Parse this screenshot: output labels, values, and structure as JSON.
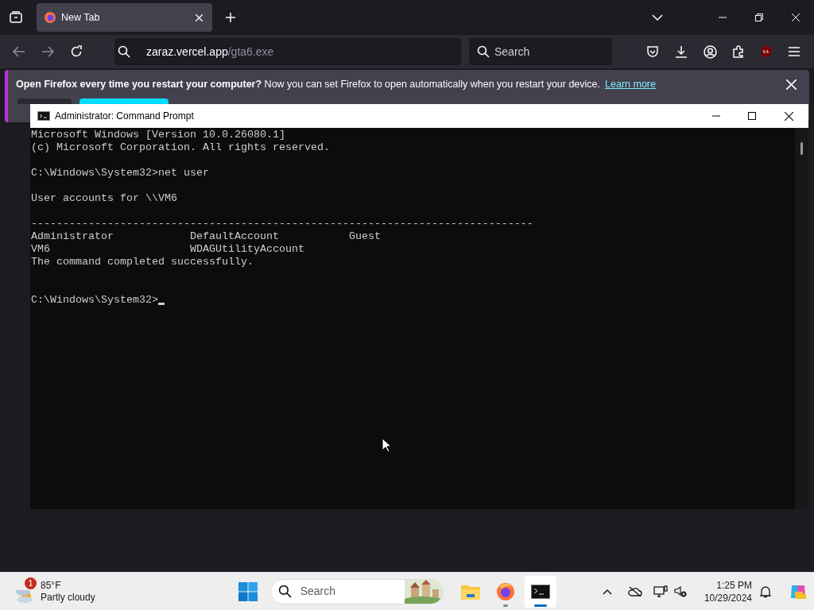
{
  "browser": {
    "tabs": [
      {
        "label": "New Tab",
        "selected": true
      }
    ],
    "url": {
      "host": "zaraz.vercel.app",
      "path": "/gta6.exe"
    },
    "search": {
      "placeholder": "Search"
    },
    "notification": {
      "bold": "Open Firefox every time you restart your computer?",
      "text": "Now you can set Firefox to open automatically when you restart your device.",
      "link": "Learn more"
    },
    "page_buttons": [
      {
        "kind": "secondary"
      },
      {
        "kind": "primary"
      }
    ]
  },
  "console": {
    "title": "Administrator: Command Prompt",
    "blocks": [
      [
        "Microsoft Windows [Version 10.0.26080.1]",
        "(c) Microsoft Corporation. All rights reserved."
      ],
      [
        "C:\\Windows\\System32>net user"
      ],
      [
        "User accounts for \\\\VM6"
      ],
      [
        "-------------------------------------------------------------------------------",
        "Administrator            DefaultAccount           Guest",
        "VM6                      WDAGUtilityAccount",
        "The command completed successfully."
      ]
    ],
    "prompt": "C:\\Windows\\System32>"
  },
  "taskbar": {
    "weather": {
      "badge": "1",
      "temperature": "85°F",
      "condition": "Partly cloudy"
    },
    "search": {
      "placeholder": "Search"
    },
    "apps": [
      {
        "kind": "folder",
        "active": false
      },
      {
        "kind": "firefox",
        "active": false
      },
      {
        "kind": "terminal",
        "active": true
      }
    ],
    "time": "1:25 PM",
    "date": "10/29/2024"
  }
}
